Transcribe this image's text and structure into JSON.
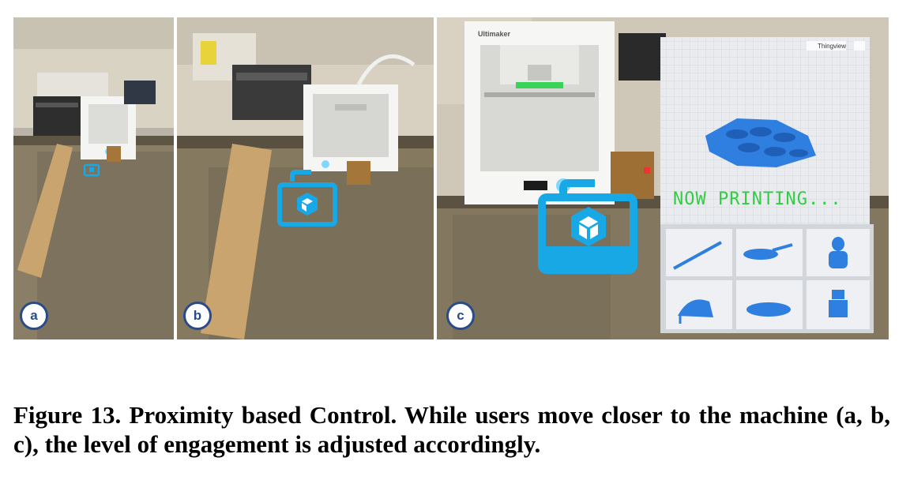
{
  "panels": [
    {
      "id": "a",
      "label": "a"
    },
    {
      "id": "b",
      "label": "b"
    },
    {
      "id": "c",
      "label": "c"
    }
  ],
  "printer_brand": "Ultimaker",
  "viewer": {
    "status_text": "NOW PRINTING...",
    "viewer_label": "Thingview",
    "thumbnails": [
      "sword-model",
      "spaceship-model",
      "bust-model",
      "high-heel-model",
      "car-model",
      "robot-model"
    ]
  },
  "caption": {
    "text": "Figure 13.  Proximity based Control.  While users move closer to the machine (a, b, c), the level of engagement is adjusted accordingly."
  },
  "colors": {
    "ar_icon": "#19a8e6",
    "model_blue": "#2f7fe0",
    "hud_green": "#33cc44",
    "badge_border": "#2a4b8a"
  }
}
